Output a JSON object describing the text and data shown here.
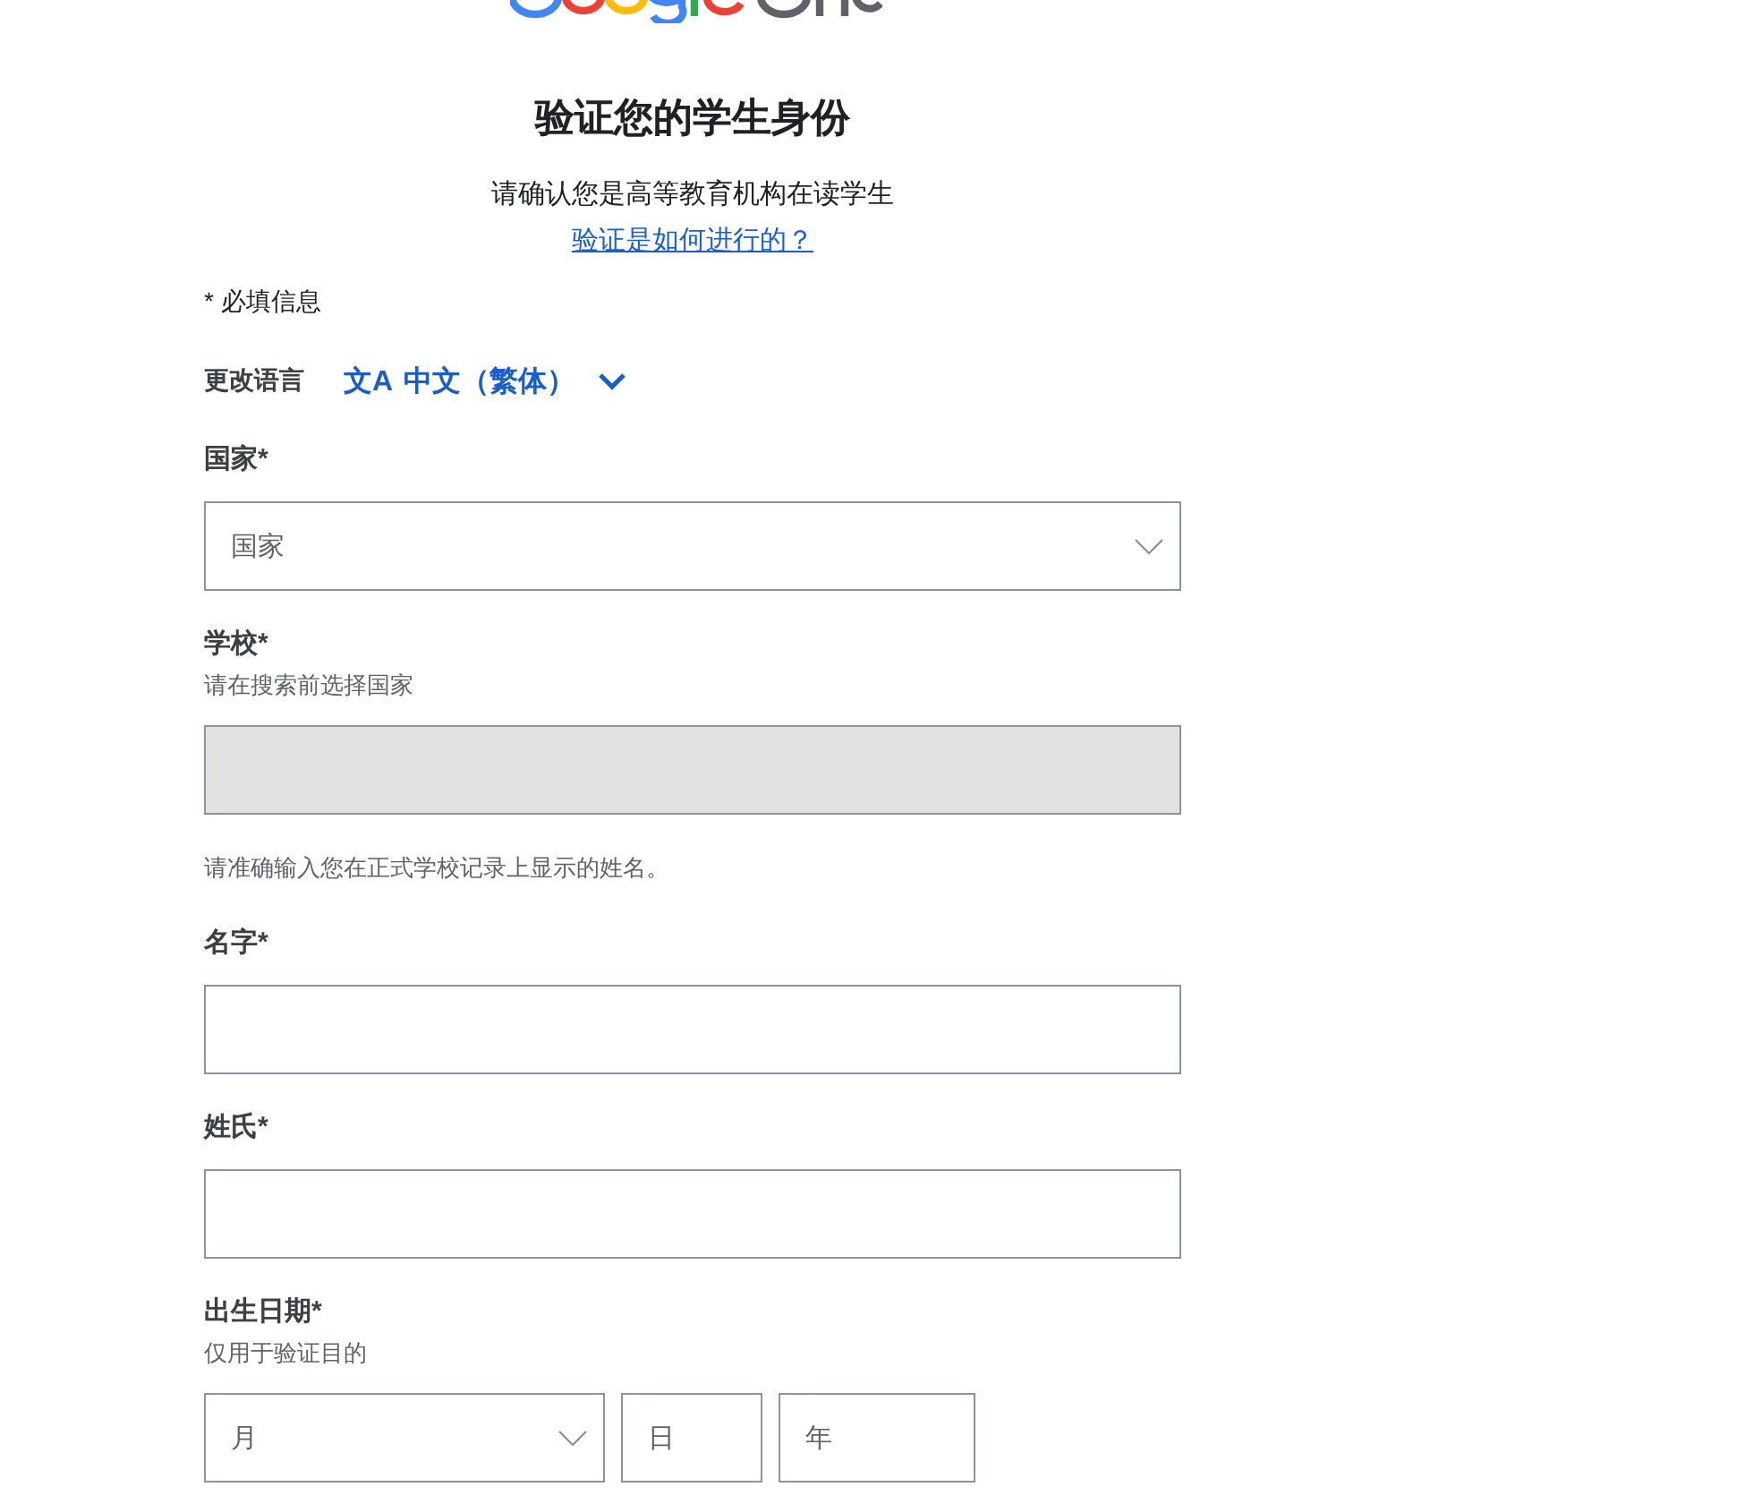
{
  "header": {
    "title": "验证您的学生身份",
    "subtitle": "请确认您是高等教育机构在读学生",
    "help_link": "验证是如何进行的？"
  },
  "required_note": "* 必填信息",
  "language": {
    "label": "更改语言",
    "glyph": "文A",
    "value": "中文（繁体）"
  },
  "fields": [
    {
      "kind": "select",
      "label": "国家*",
      "placeholder": "国家",
      "disabled": false
    },
    {
      "kind": "text",
      "label": "学校*",
      "hint": "请在搜索前选择国家",
      "disabled": true
    },
    {
      "kind": "text",
      "note": "请准确输入您在正式学校记录上显示的姓名。",
      "label": "名字*",
      "disabled": false
    },
    {
      "kind": "text",
      "label": "姓氏*",
      "disabled": false
    },
    {
      "kind": "date",
      "label": "出生日期*",
      "hint": "仅用于验证目的",
      "disabled": false,
      "parts": [
        {
          "kind": "select",
          "placeholder": "月"
        },
        {
          "kind": "text",
          "placeholder": "日"
        },
        {
          "kind": "text",
          "placeholder": "年"
        }
      ]
    }
  ]
}
